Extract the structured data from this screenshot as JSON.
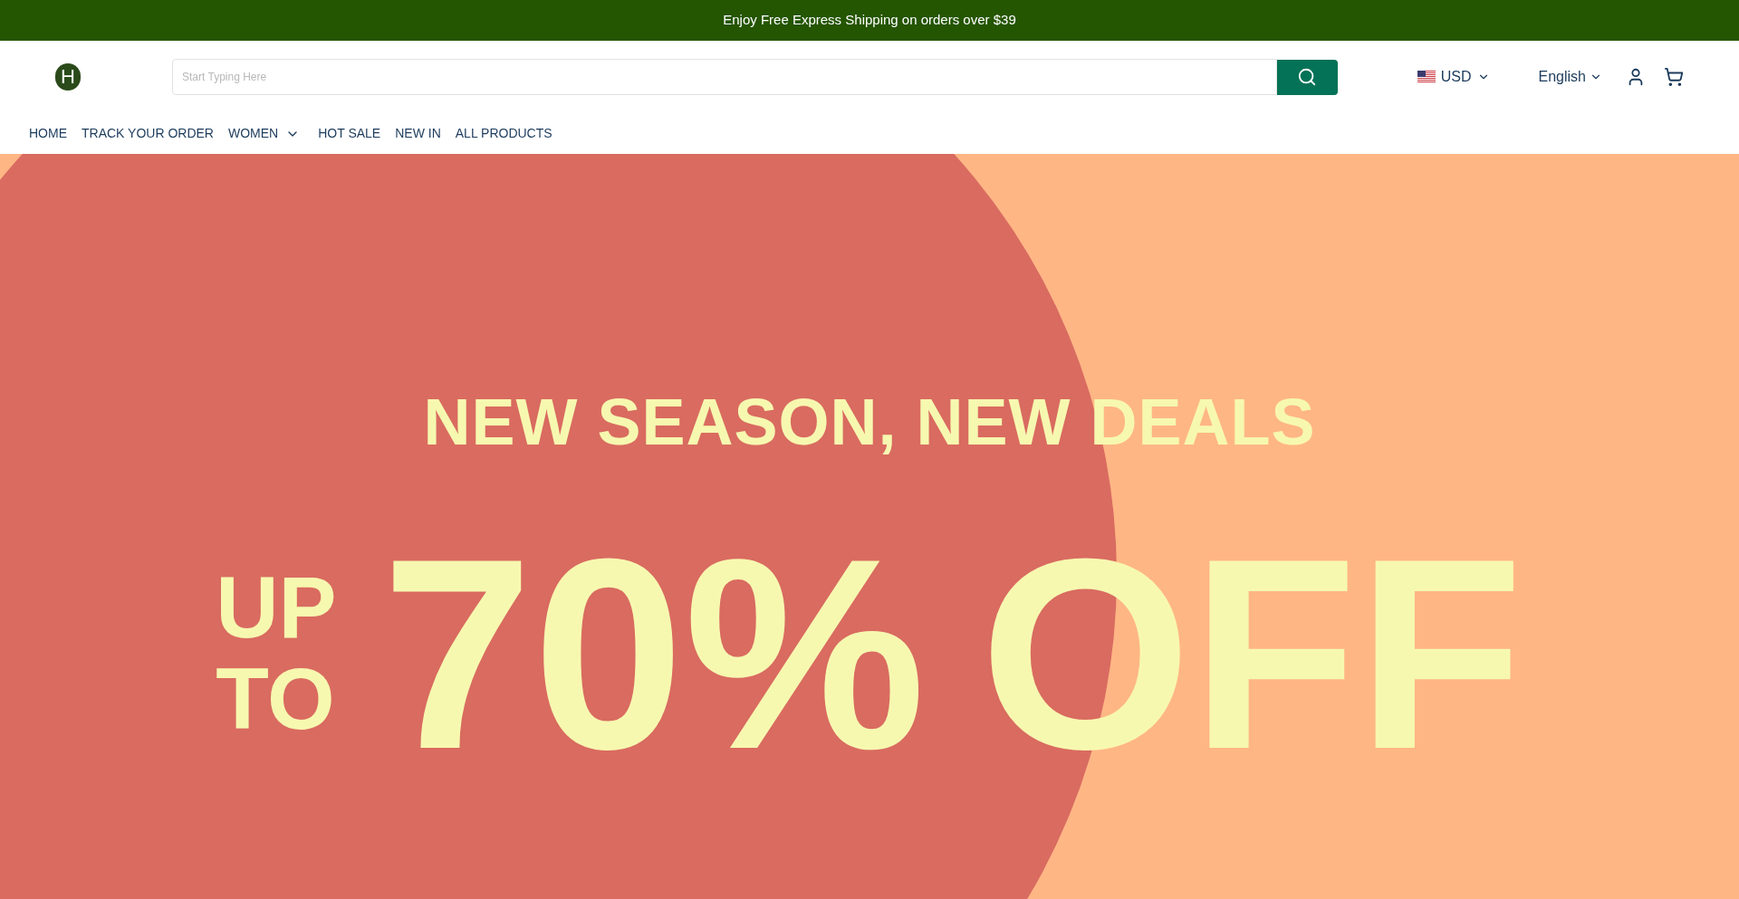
{
  "announcement": "Enjoy Free Express Shipping on orders over $39",
  "header": {
    "logo": "H",
    "search": {
      "placeholder": "Start Typing Here"
    },
    "currency": "USD",
    "language": "English"
  },
  "nav": [
    {
      "label": "HOME",
      "has_dropdown": false
    },
    {
      "label": "TRACK YOUR ORDER",
      "has_dropdown": false
    },
    {
      "label": "WOMEN",
      "has_dropdown": true
    },
    {
      "label": "HOT SALE",
      "has_dropdown": false
    },
    {
      "label": "NEW IN",
      "has_dropdown": false
    },
    {
      "label": "ALL PRODUCTS",
      "has_dropdown": false
    }
  ],
  "hero": {
    "headline": "NEW SEASON, NEW DEALS",
    "prefix_line_1": "UP",
    "prefix_line_2": "TO",
    "amount": "70%",
    "suffix": "OFF"
  }
}
